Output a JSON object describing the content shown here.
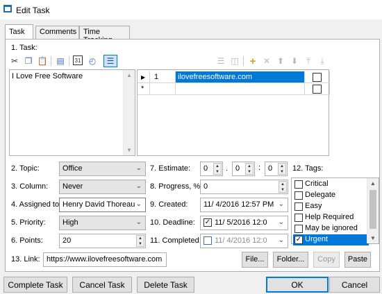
{
  "window": {
    "title": "Edit Task"
  },
  "tabs": [
    {
      "label": "Task",
      "active": true
    },
    {
      "label": "Comments",
      "active": false
    },
    {
      "label": "Time Tracking",
      "active": false
    }
  ],
  "task_section": {
    "label": "1. Task:",
    "text": "I Love Free Software",
    "toolbar_icons": [
      "cut-icon",
      "copy-icon",
      "paste-icon",
      "paste-special-icon",
      "calendar-icon",
      "clock-icon",
      "list-icon"
    ],
    "grid_toolbar_icons": [
      "rows-icon",
      "columns-icon",
      "add-icon",
      "delete-icon",
      "move-up-icon",
      "move-down-icon",
      "move-top-icon",
      "move-bottom-icon"
    ]
  },
  "subtasks": [
    {
      "marker": "▶",
      "number": "1",
      "text": "ilovefreesoftware.com",
      "checked": false
    },
    {
      "marker": "*",
      "number": "",
      "text": "",
      "checked": false
    }
  ],
  "fields": {
    "topic": {
      "label": "2. Topic:",
      "value": "Office"
    },
    "column": {
      "label": "3. Column:",
      "value": "Never"
    },
    "assigned": {
      "label": "4. Assigned to:",
      "value": "Henry David Thoreau"
    },
    "priority": {
      "label": "5. Priority:",
      "value": "High"
    },
    "points": {
      "label": "6. Points:",
      "value": "20"
    },
    "estimate": {
      "label": "7. Estimate:",
      "h": "0",
      "m": "0",
      "s": "0",
      "dot": ".",
      "colon": ":"
    },
    "progress": {
      "label": "8. Progress, %:",
      "value": "0"
    },
    "created": {
      "label": "9. Created:",
      "value": "11/  4/2016 12:57 PM"
    },
    "deadline": {
      "label": "10. Deadline:",
      "value": "11/  5/2016  12:0",
      "checked": true
    },
    "completed": {
      "label": "11. Completed:",
      "value": "11/  4/2016  12:0",
      "checked": false
    },
    "tags_label": "12. Tags:",
    "link": {
      "label": "13. Link:",
      "value": "https://www.ilovefreesoftware.com"
    }
  },
  "tags": [
    {
      "name": "Critical",
      "checked": false,
      "selected": false
    },
    {
      "name": "Delegate",
      "checked": false,
      "selected": false
    },
    {
      "name": "Easy",
      "checked": false,
      "selected": false
    },
    {
      "name": "Help Required",
      "checked": false,
      "selected": false
    },
    {
      "name": "May be ignored",
      "checked": false,
      "selected": false
    },
    {
      "name": "Urgent",
      "checked": true,
      "selected": true
    }
  ],
  "link_buttons": {
    "file": "File...",
    "folder": "Folder...",
    "copy": "Copy",
    "paste": "Paste"
  },
  "footer": {
    "complete": "Complete Task",
    "cancel_task": "Cancel Task",
    "delete": "Delete Task",
    "ok": "OK",
    "cancel": "Cancel"
  },
  "colors": {
    "accent": "#0078d7",
    "selection": "#0078d7",
    "window_bg": "#f0f0f0"
  }
}
